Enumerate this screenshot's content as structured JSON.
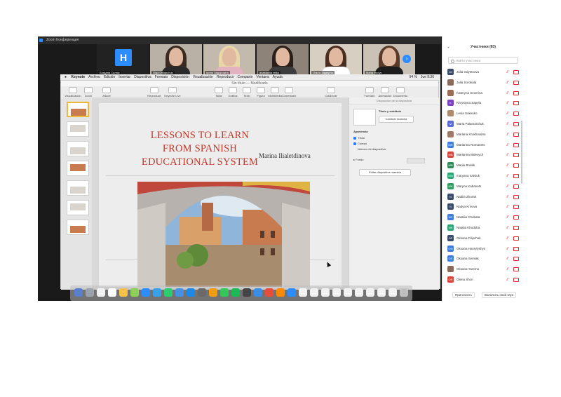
{
  "zoom": {
    "window_title": "Zoom Конференция",
    "participants_strip": [
      {
        "name": "Богдана Салюк",
        "initial": "H",
        "type": "avatar"
      },
      {
        "name": "Olga Ostapchuk",
        "type": "video",
        "hair": "#3b2a22",
        "shirt": "#2a2a2a",
        "bg": "#b9b1a6"
      },
      {
        "name": "Ірина Задорожна",
        "type": "video",
        "hair": "#e8d8a8",
        "shirt": "#e2b2c0",
        "bg": "#c3b9ad"
      },
      {
        "name": "anastasiia reiko",
        "type": "video",
        "hair": "#2c1f1a",
        "shirt": "#3c3c3c",
        "bg": "#8d8378"
      },
      {
        "name": "Ольга Задвірна",
        "type": "video",
        "hair": "#4a2f20",
        "shirt": "#ffffff",
        "bg": "#d8cfc3"
      },
      {
        "name": "Maria Hudyk",
        "type": "video",
        "hair": "#5a3b28",
        "shirt": "#1d1d1d",
        "bg": "#cbc2b7"
      }
    ],
    "next_arrow": "›"
  },
  "mac_menu": [
    "Keynote",
    "Archivo",
    "Edición",
    "Insertar",
    "Diapositiva",
    "Formato",
    "Disposición",
    "Visualización",
    "Reproducir",
    "Compartir",
    "Ventana",
    "Ayuda"
  ],
  "mac_status": {
    "battery": "94 %",
    "time": "Jue 9:30"
  },
  "keynote": {
    "doc_title": "Sin título — Modificado",
    "toolbar_left": [
      {
        "label": "Visualización"
      },
      {
        "label": "Zoom",
        "value": "100 %"
      },
      {
        "label": "Añadir diapositiva"
      }
    ],
    "toolbar_mid": [
      {
        "label": "Reproducir"
      },
      {
        "label": "Keynote Live"
      }
    ],
    "toolbar_insert": [
      "Tabla",
      "Gráfica",
      "Texto",
      "Figura",
      "Multimedia",
      "Comentario"
    ],
    "toolbar_collab": "Colaborar",
    "toolbar_right": [
      "Formato",
      "Animación",
      "Documento"
    ],
    "slide": {
      "title": "LESSONS TO LEARN FROM SPANISH EDUCATIONAL SYSTEM",
      "author": "Marina Ilialetdinova"
    },
    "thumb_count": 7,
    "sidebar": {
      "header": "Disposición de la diapositiva",
      "layout_name": "Título y subtítulo",
      "change_master": "Cambiar maestra",
      "appearance": "Apariencia",
      "opt_title": "Título",
      "opt_body": "Cuerpo",
      "opt_number": "Número de diapositiva",
      "background": "Fondo",
      "edit_master": "Editar diapositiva maestra"
    }
  },
  "participants_panel": {
    "header": "Участники (83)",
    "search_placeholder": "Найти участника",
    "list": [
      {
        "initials": "JO",
        "name": "Julia Odyntsova",
        "color": "#3a4a6b"
      },
      {
        "initials": "",
        "name": "Julia Sorokala",
        "color": "#8a6a5a"
      },
      {
        "initials": "",
        "name": "Kateryna Severina",
        "color": "#9b6b52"
      },
      {
        "initials": "K",
        "name": "Khrystyna Sapyla",
        "color": "#7b3fc4"
      },
      {
        "initials": "",
        "name": "Lesia Sokenko",
        "color": "#b08a6a"
      },
      {
        "initials": "M",
        "name": "Maria Palamarchuk",
        "color": "#5b6ad9"
      },
      {
        "initials": "",
        "name": "Mariana Krokhmalna",
        "color": "#a07a68"
      },
      {
        "initials": "MR",
        "name": "Marianna Romanets",
        "color": "#3d7de0"
      },
      {
        "initials": "MB",
        "name": "Marianna Balevych",
        "color": "#d9433a"
      },
      {
        "initials": "MB",
        "name": "Mariia Bodak",
        "color": "#2e8b57"
      },
      {
        "initials": "MN",
        "name": "maryana natsiuk",
        "color": "#2aa876"
      },
      {
        "initials": "MK",
        "name": "Maryna Kabanets",
        "color": "#2e9e5e"
      },
      {
        "initials": "N",
        "name": "Nadiia Zhurak",
        "color": "#3a4a6b"
      },
      {
        "initials": "N",
        "name": "Nadya Krivova",
        "color": "#3a4a6b"
      },
      {
        "initials": "NC",
        "name": "Nataliia Chubata",
        "color": "#3d7de0"
      },
      {
        "initials": "NK",
        "name": "Natalia Khodoba",
        "color": "#2aa876"
      },
      {
        "initials": "OF",
        "name": "Oksana Filipchuk",
        "color": "#3a4a6b"
      },
      {
        "initials": "OH",
        "name": "Oksana Havrylyshyn",
        "color": "#3d7de0"
      },
      {
        "initials": "OS",
        "name": "Oksana Semiak",
        "color": "#3d7de0"
      },
      {
        "initials": "",
        "name": "Oksana Yarema",
        "color": "#8a6a5a"
      },
      {
        "initials": "OS",
        "name": "Olena Shcn",
        "color": "#d9433a"
      }
    ],
    "invite": "Пригласить",
    "unmute": "Включить свой звук"
  },
  "dock_colors": [
    "#5a7fd0",
    "#9aa3ad",
    "#f2f2f2",
    "#ffffff",
    "#f6c04a",
    "#8fd05a",
    "#2d8cff",
    "#3aa0e8",
    "#2ecc71",
    "#4a90e2",
    "#1e88e5",
    "#6a6a6a",
    "#f39c12",
    "#34c759",
    "#1db954",
    "#444444",
    "#3b8ee8",
    "#e74c3c",
    "#ff8a00",
    "#2d8cff",
    "#f2f2f2",
    "#f2f2f2",
    "#f2f2f2",
    "#f2f2f2",
    "#f2f2f2",
    "#f2f2f2",
    "#f2f2f2",
    "#f2f2f2",
    "#f2f2f2",
    "#c0c0c0"
  ]
}
